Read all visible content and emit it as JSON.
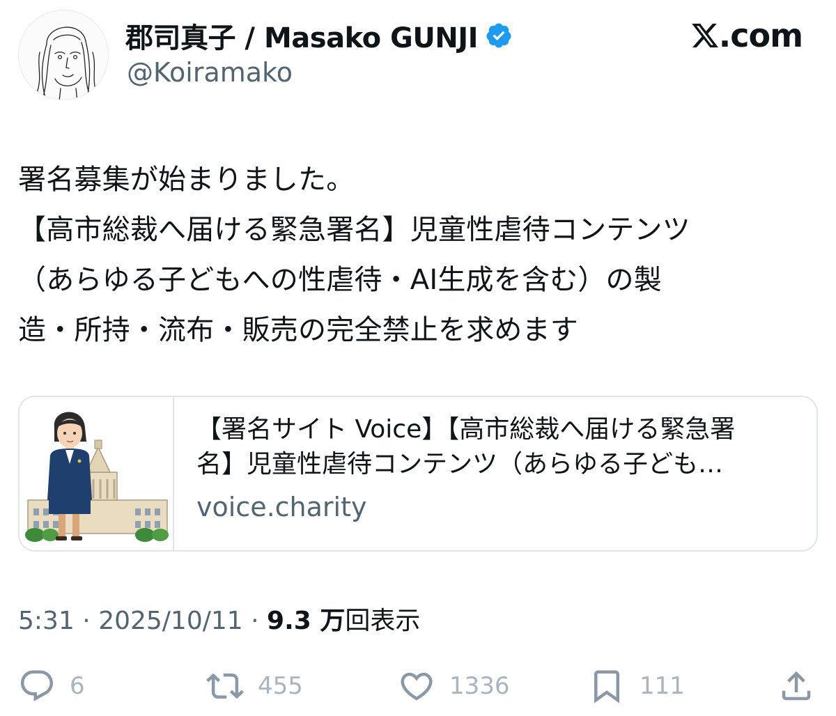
{
  "author": {
    "display_name": "郡司真子 / Masako GUNJI",
    "handle": "@Koiramako",
    "verified_badge_icon": "verified-badge-icon",
    "verified_color": "#1d9bf0"
  },
  "brand": {
    "logo_icon": "x-logo-icon",
    "text": ".com"
  },
  "tweet": {
    "lines": [
      "署名募集が始まりました。",
      "【高市総裁へ届ける緊急署名】児童性虐待コンテンツ",
      "（あらゆる子どもへの性虐待・AI生成を含む）の製",
      "造・所持・流布・販売の完全禁止を求めます"
    ]
  },
  "link_card": {
    "title_line1": "【署名サイト Voice】【高市総裁へ届ける緊急署",
    "title_line2": "名】児童性虐待コンテンツ（あらゆる子ども…",
    "domain": "voice.charity",
    "thumbnail_icon": "politician-parliament-illustration"
  },
  "meta": {
    "time": "5:31",
    "separator": " · ",
    "date": "2025/10/11",
    "views_count": "9.3 万",
    "views_label": "回表示"
  },
  "actions": {
    "reply": {
      "icon": "reply-icon",
      "count": "6"
    },
    "retweet": {
      "icon": "retweet-icon",
      "count": "455"
    },
    "like": {
      "icon": "heart-icon",
      "count": "1336"
    },
    "bookmark": {
      "icon": "bookmark-icon",
      "count": "111"
    },
    "share": {
      "icon": "share-icon"
    }
  }
}
